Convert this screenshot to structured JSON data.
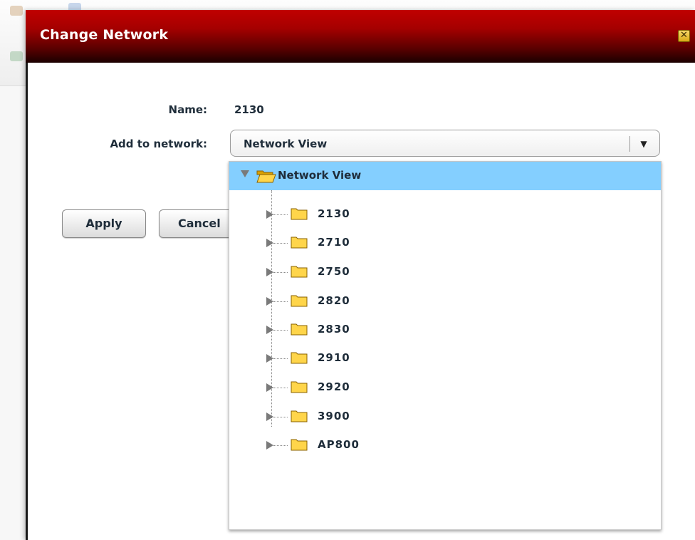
{
  "dialog": {
    "title": "Change Network",
    "close_label": "✕"
  },
  "form": {
    "name_label": "Name:",
    "name_value": "2130",
    "network_label": "Add to network:",
    "network_value": "Network View",
    "dropdown_arrow": "▼"
  },
  "buttons": {
    "apply": "Apply",
    "cancel": "Cancel"
  },
  "tree": {
    "root": "Network View",
    "items": [
      "2130",
      "2710",
      "2750",
      "2820",
      "2830",
      "2910",
      "2920",
      "3900",
      "AP800"
    ]
  },
  "colors": {
    "title_bar": "#a50000",
    "selection": "#84cfff",
    "folder": "#f4c430"
  },
  "icons": {
    "close": "close-icon",
    "folder_open": "folder-open-icon",
    "folder": "folder-icon",
    "expand": "triangle-right-icon",
    "collapse": "triangle-down-icon"
  }
}
